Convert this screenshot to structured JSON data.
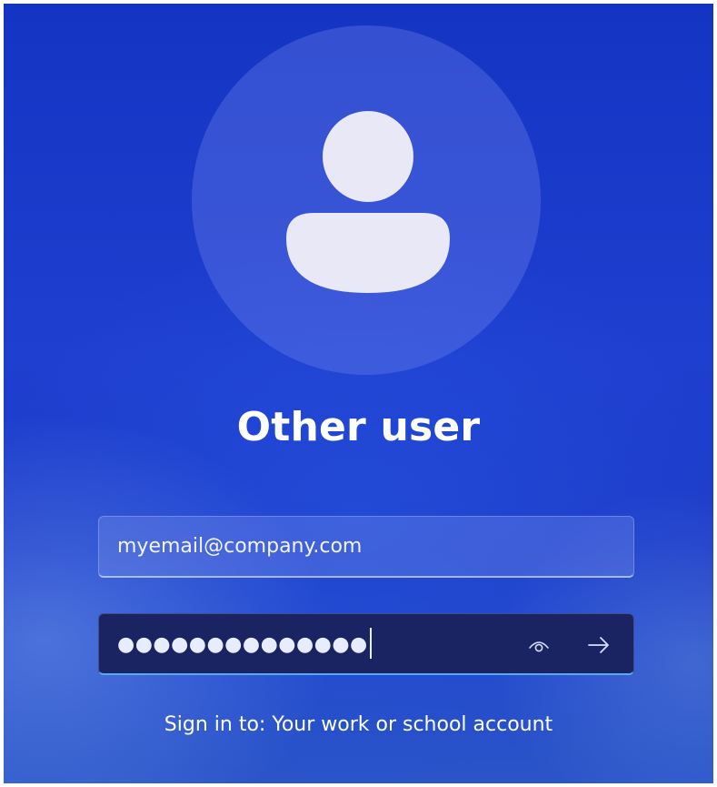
{
  "login": {
    "title": "Other user",
    "email_value": "myemail@company.com",
    "password_masked": "●●●●●●●●●●●●●●",
    "footer_text": "Sign in to: Your work or school account"
  },
  "icons": {
    "avatar": "user-silhouette-icon",
    "reveal": "eye-icon",
    "submit": "arrow-right-icon"
  },
  "colors": {
    "background_primary": "#1f3fd0",
    "avatar_fill": "#e8e8f6",
    "password_field_bg": "#1a2463",
    "focus_underline": "#5aa8f0",
    "text": "#ffffff"
  }
}
